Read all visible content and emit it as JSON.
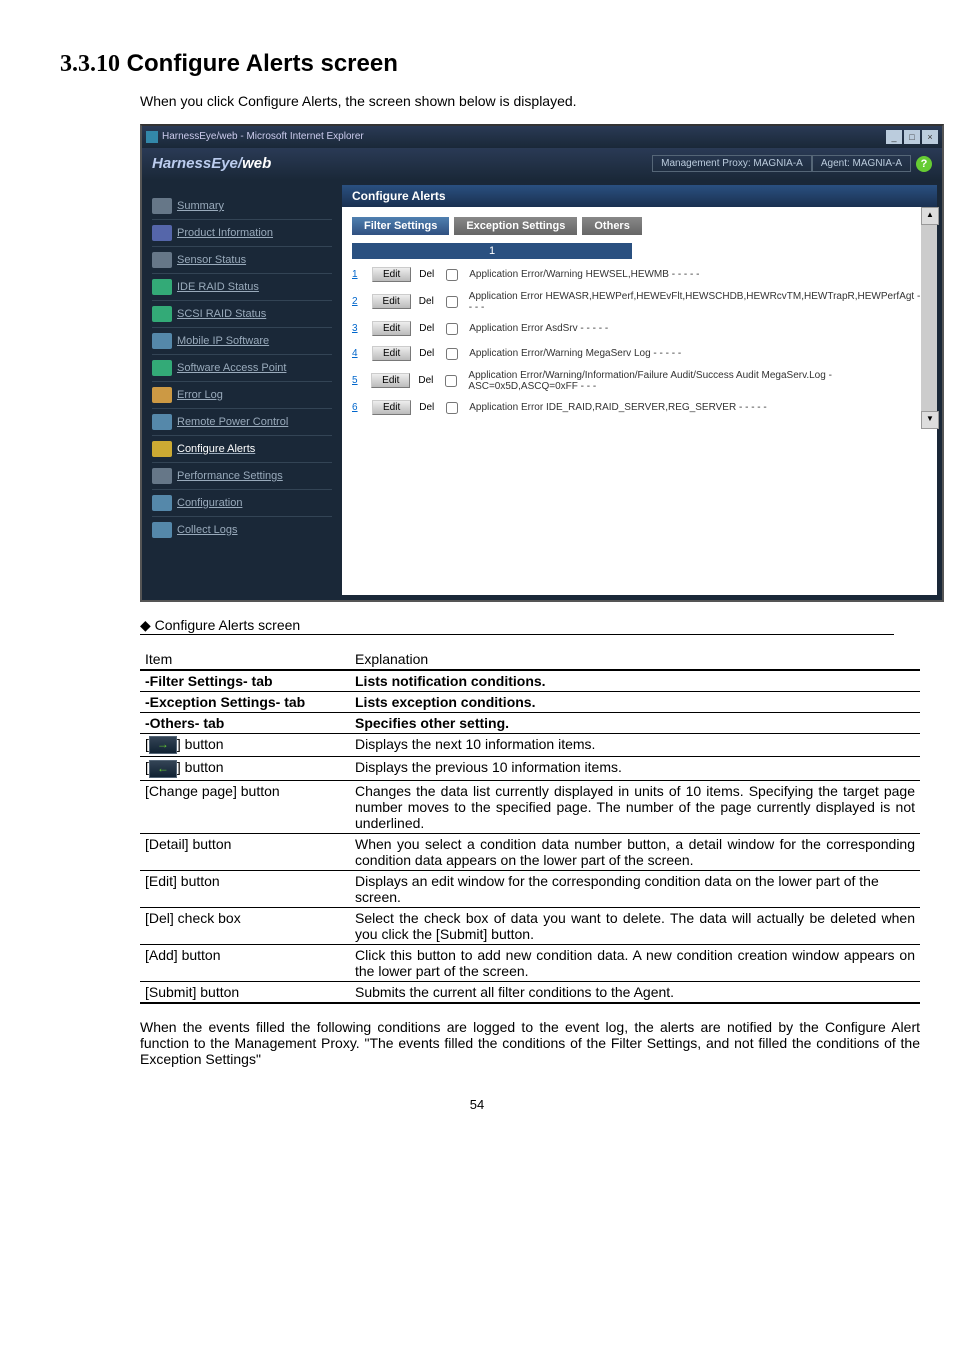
{
  "heading_num": "3.3.10",
  "heading_text": "Configure Alerts screen",
  "intro": "When you click Configure Alerts, the screen shown below is displayed.",
  "window": {
    "title": "HarnessEye/web - Microsoft Internet Explorer",
    "logo_primary": "HarnessEye/",
    "logo_secondary": "web",
    "mgmt_proxy": "Management Proxy: MAGNIA-A",
    "agent": "Agent: MAGNIA-A",
    "help": "?",
    "minimize": "_",
    "maximize": "□",
    "close": "×"
  },
  "nav": {
    "summary": "Summary",
    "product": "Product Information",
    "sensor": "Sensor Status",
    "ide": "IDE RAID Status",
    "scsi": "SCSI RAID Status",
    "mobile": "Mobile IP Software",
    "sap": "Software Access Point",
    "error": "Error Log",
    "remote": "Remote Power Control",
    "configure": "Configure Alerts",
    "perf": "Performance Settings",
    "config": "Configuration",
    "logs": "Collect Logs"
  },
  "panel": {
    "title": "Configure Alerts",
    "tab_filter": "Filter Settings",
    "tab_exception": "Exception Settings",
    "tab_others": "Others",
    "page_ind": "1",
    "edit_label": "Edit",
    "del_label": "Del"
  },
  "rows": [
    {
      "n": "1",
      "text": "Application Error/Warning HEWSEL,HEWMB - - - - -"
    },
    {
      "n": "2",
      "text": "Application Error HEWASR,HEWPerf,HEWEvFlt,HEWSCHDB,HEWRcvTM,HEWTrapR,HEWPerfAgt - - - - -"
    },
    {
      "n": "3",
      "text": "Application Error AsdSrv - - - - -"
    },
    {
      "n": "4",
      "text": "Application Error/Warning MegaServ Log - - - - -"
    },
    {
      "n": "5",
      "text": "Application Error/Warning/Information/Failure Audit/Success Audit MegaServ.Log - ASC=0x5D,ASCQ=0xFF - - -"
    },
    {
      "n": "6",
      "text": "Application Error IDE_RAID,RAID_SERVER,REG_SERVER - - - - -"
    }
  ],
  "subtitle": "◆ Configure Alerts screen",
  "table": {
    "h_item": "Item",
    "h_exp": "Explanation",
    "r_filter_i": "-Filter Settings- tab",
    "r_filter_e": "Lists notification conditions.",
    "r_exc_i": "-Exception Settings- tab",
    "r_exc_e": "Lists exception conditions.",
    "r_oth_i": "-Others- tab",
    "r_oth_e": "Specifies other setting.",
    "r_next_e": "Displays the next 10 information items.",
    "r_prev_e": "Displays the previous 10 information items.",
    "r_change_i": "[Change page] button",
    "r_change_e": "Changes the data list currently displayed in units of 10 items. Specifying the target page number moves to the specified page. The number of the page currently displayed is not underlined.",
    "r_detail_i": "[Detail] button",
    "r_detail_e": "When you select a condition data number button, a detail window for the corresponding condition data appears on the lower part of the screen.",
    "r_edit_i": "[Edit] button",
    "r_edit_e": "Displays an edit window for the corresponding condition data on the lower part of the screen.",
    "r_del_i": "[Del] check box",
    "r_del_e": "Select the check box of data you want to delete.  The data will actually be deleted when you click the [Submit] button.",
    "r_add_i": "[Add] button",
    "r_add_e": "Click this button to add new condition data.  A new condition creation window appears on the lower part of the screen.",
    "r_submit_i": "[Submit] button",
    "r_submit_e": "Submits the current all filter conditions to the Agent.",
    "btn_suffix": " button"
  },
  "footer": "When the events filled the following conditions are logged to the event log, the alerts are notified by the Configure Alert function to the Management Proxy. \"The events filled the conditions of the Filter Settings, and not filled the conditions of the Exception Settings\"",
  "page": "54"
}
